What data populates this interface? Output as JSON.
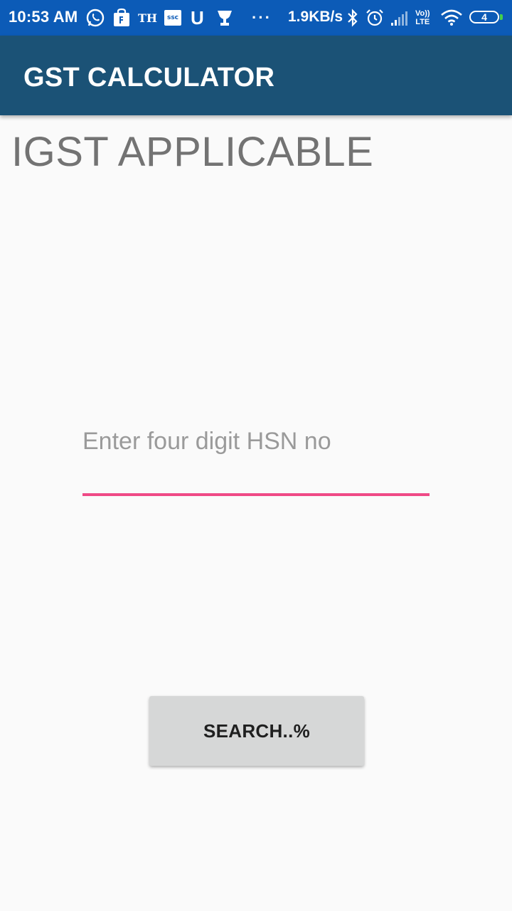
{
  "status_bar": {
    "time": "10:53 AM",
    "network_speed": "1.9KB/s",
    "battery_level": "4",
    "notification_icons": [
      "whatsapp-icon",
      "shopping-bag-icon",
      "th-icon",
      "ssc-icon",
      "u-icon",
      "trophy-icon",
      "more-dots-icon"
    ],
    "th_text": "TH",
    "ssc_text": "ssc",
    "u_text": "U",
    "volte_text_top": "Vo))",
    "volte_text_bottom": "LTE",
    "dots": "···"
  },
  "app_bar": {
    "title": "GST CALCULATOR",
    "color": "#1b5276"
  },
  "main": {
    "heading": "IGST APPLICABLE",
    "hsn_input": {
      "placeholder": "Enter four digit HSN no",
      "value": "",
      "accent_color": "#ef4a86"
    },
    "search_button_label": "SEARCH..%"
  }
}
